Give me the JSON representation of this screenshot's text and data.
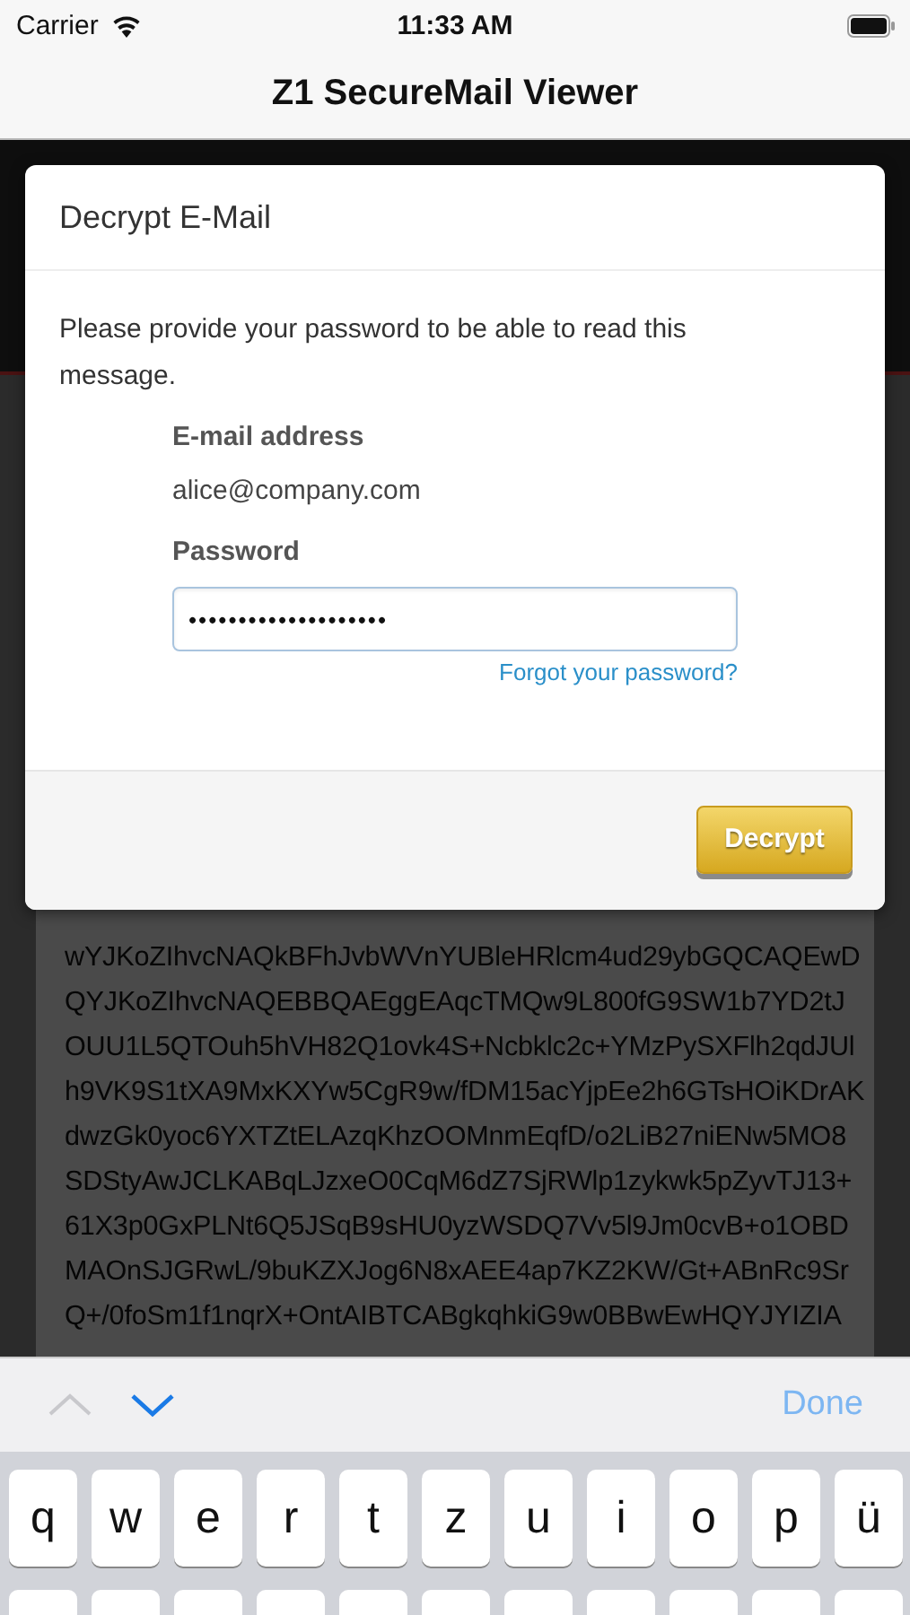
{
  "status_bar": {
    "carrier": "Carrier",
    "time": "11:33 AM"
  },
  "nav_bar": {
    "title": "Z1 SecureMail Viewer"
  },
  "message_body": {
    "lines": [
      "wYJKoZIhvcNAQkBFhJvbWVnYUBleHRlcm4ud29ybGQCAQEwD",
      "QYJKoZIhvcNAQEBBQAEggEAqcTMQw9L800fG9SW1b7YD2tJ",
      "OUU1L5QTOuh5hVH82Q1ovk4S+Ncbklc2c+YMzPySXFlh2qdJUl",
      "h9VK9S1tXA9MxKXYw5CgR9w/fDM15acYjpEe2h6GTsHOiKDrAK",
      "dwzGk0yoc6YXTZtELAzqKhzOOMnmEqfD/o2LiB27niENw5MO8",
      "SDStyAwJCLKABqLJzxeO0CqM6dZ7SjRWlp1zykwk5pZyvTJ13+",
      "61X3p0GxPLNt6Q5JSqB9sHU0yzWSDQ7Vv5l9Jm0cvB+o1OBD",
      "MAOnSJGRwL/9buKZXJog6N8xAEE4ap7KZ2KW/Gt+ABnRc9Sr",
      "Q+/0foSm1f1nqrX+OntAIBTCABgkqhkiG9w0BBwEwHQYJYIZIA"
    ]
  },
  "dialog": {
    "title": "Decrypt E-Mail",
    "message": "Please provide your password to be able to read this message.",
    "email_label": "E-mail address",
    "email": "alice@company.com",
    "password_label": "Password",
    "password_value": "••••••••••••••••••••",
    "forgot_link": "Forgot your password?",
    "button": "Decrypt"
  },
  "keyboard_toolbar": {
    "previous_disabled": true,
    "next_disabled": false,
    "done": "Done"
  },
  "keyboard": {
    "rows": [
      [
        "q",
        "w",
        "e",
        "r",
        "t",
        "z",
        "u",
        "i",
        "o",
        "p",
        "ü"
      ]
    ]
  }
}
